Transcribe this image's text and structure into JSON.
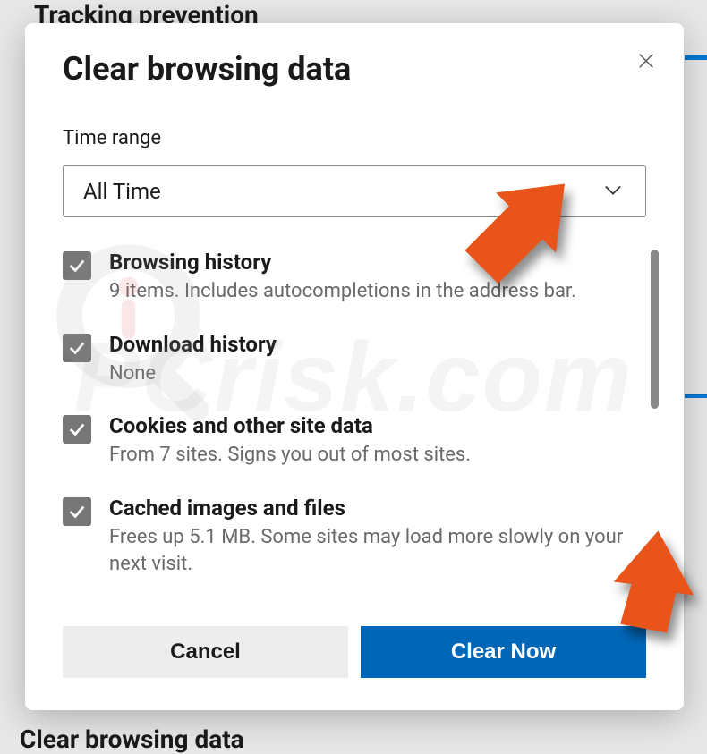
{
  "backdrop": {
    "top_heading": "Tracking prevention",
    "bottom_heading": "Clear browsing data"
  },
  "dialog": {
    "title": "Clear browsing data",
    "time_range_label": "Time range",
    "time_range_value": "All Time",
    "options": [
      {
        "title": "Browsing history",
        "desc": "9 items. Includes autocompletions in the address bar.",
        "checked": true
      },
      {
        "title": "Download history",
        "desc": "None",
        "checked": true
      },
      {
        "title": "Cookies and other site data",
        "desc": "From 7 sites. Signs you out of most sites.",
        "checked": true
      },
      {
        "title": "Cached images and files",
        "desc": "Frees up 5.1 MB. Some sites may load more slowly on your next visit.",
        "checked": true
      }
    ],
    "cancel_label": "Cancel",
    "clear_label": "Clear Now"
  },
  "watermark": {
    "text": "PCrisk.com"
  }
}
